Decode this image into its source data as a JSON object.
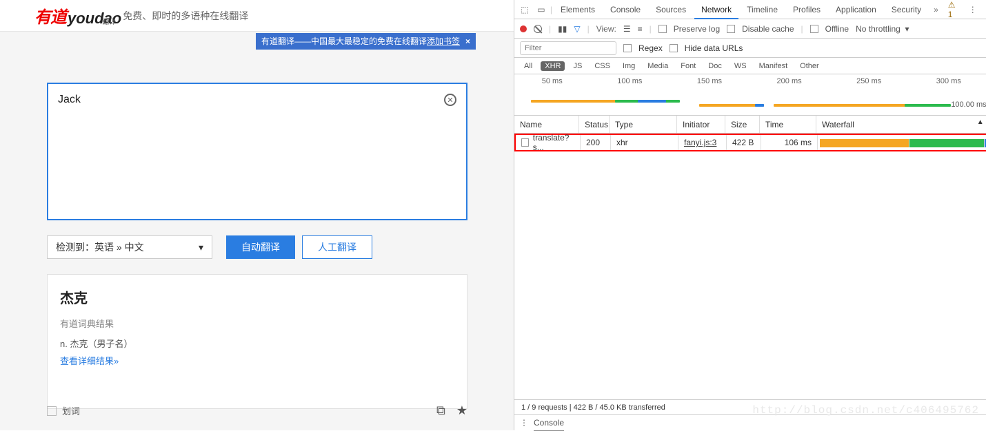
{
  "header": {
    "logo_red": "有道",
    "logo_black": "youdao",
    "logo_under": "翻译",
    "tagline": "免费、即时的多语种在线翻译"
  },
  "bookmark": {
    "text_a": "有道翻译——中国最大最稳定的免费在线翻译 ",
    "link": "添加书签",
    "close": "×"
  },
  "translate": {
    "input": "Jack",
    "lang_selected": "检测到：英语 » 中文",
    "btn_auto": "自动翻译",
    "btn_manual": "人工翻译",
    "result_title": "杰克",
    "dict_label": "有道词典结果",
    "dict_entry": "n. 杰克（男子名）",
    "dict_more": "查看详细结果»",
    "huaci": "划词"
  },
  "devtools": {
    "tabs": [
      "Elements",
      "Console",
      "Sources",
      "Network",
      "Timeline",
      "Profiles",
      "Application",
      "Security"
    ],
    "active_tab": "Network",
    "warn_count": "1",
    "toolbar": {
      "view": "View:",
      "preserve": "Preserve log",
      "disable_cache": "Disable cache",
      "offline": "Offline",
      "throttling": "No throttling"
    },
    "filter": {
      "placeholder": "Filter",
      "regex": "Regex",
      "hide": "Hide data URLs"
    },
    "types": [
      "All",
      "XHR",
      "JS",
      "CSS",
      "Img",
      "Media",
      "Font",
      "Doc",
      "WS",
      "Manifest",
      "Other"
    ],
    "type_selected": "XHR",
    "timeline_ticks": [
      "50 ms",
      "100 ms",
      "150 ms",
      "200 ms",
      "250 ms",
      "300 ms"
    ],
    "columns": {
      "name": "Name",
      "status": "Status",
      "type": "Type",
      "initiator": "Initiator",
      "size": "Size",
      "time": "Time",
      "waterfall": "Waterfall"
    },
    "wf_scale": "100.00 ms",
    "row": {
      "name": "translate?s...",
      "status": "200",
      "type": "xhr",
      "initiator": "fanyi.js:3",
      "size": "422 B",
      "time": "106 ms"
    },
    "status_bar": "1 / 9 requests  |  422 B / 45.0 KB transferred",
    "console_label": "Console",
    "watermark": "http://blog.csdn.net/c406495762"
  }
}
